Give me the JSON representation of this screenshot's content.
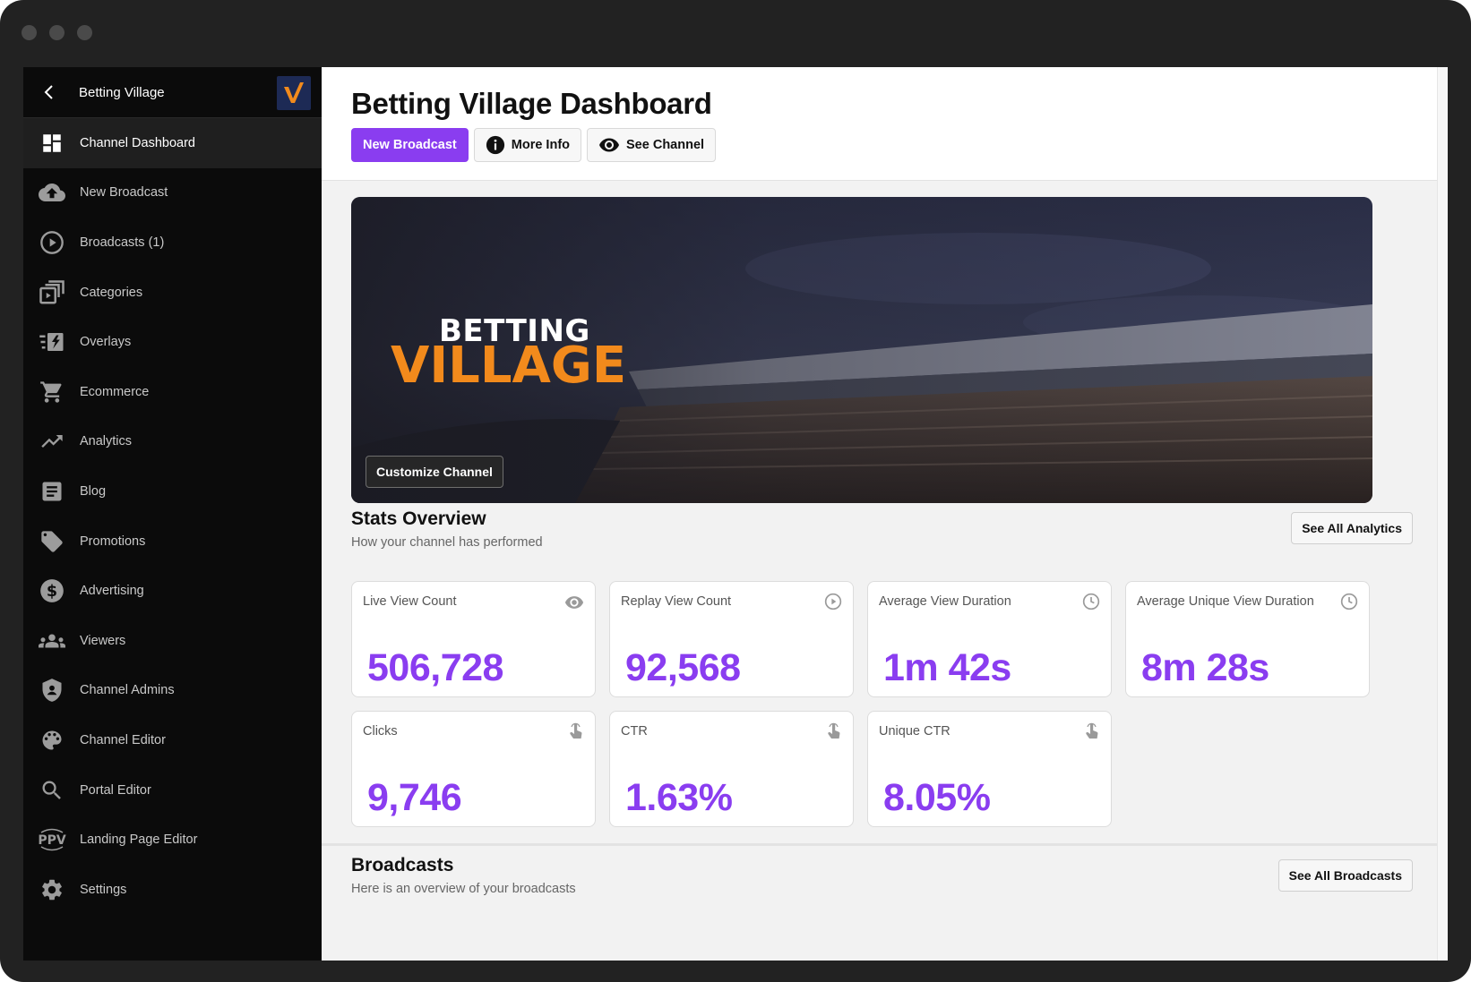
{
  "sidebar": {
    "channel_name": "Betting Village",
    "items": [
      {
        "label": "Channel Dashboard",
        "icon": "dashboard-icon"
      },
      {
        "label": "New Broadcast",
        "icon": "cloud-upload-icon"
      },
      {
        "label": "Broadcasts (1)",
        "icon": "play-circle-icon"
      },
      {
        "label": "Categories",
        "icon": "categories-icon"
      },
      {
        "label": "Overlays",
        "icon": "overlays-icon"
      },
      {
        "label": "Ecommerce",
        "icon": "cart-icon"
      },
      {
        "label": "Analytics",
        "icon": "trending-icon"
      },
      {
        "label": "Blog",
        "icon": "article-icon"
      },
      {
        "label": "Promotions",
        "icon": "tag-icon"
      },
      {
        "label": "Advertising",
        "icon": "dollar-icon"
      },
      {
        "label": "Viewers",
        "icon": "people-icon"
      },
      {
        "label": "Channel Admins",
        "icon": "shield-icon"
      },
      {
        "label": "Channel Editor",
        "icon": "palette-icon"
      },
      {
        "label": "Portal Editor",
        "icon": "search-icon"
      },
      {
        "label": "Landing Page Editor",
        "icon": "ppv-icon"
      },
      {
        "label": "Settings",
        "icon": "gear-icon"
      }
    ]
  },
  "header": {
    "title": "Betting Village Dashboard",
    "new_broadcast": "New Broadcast",
    "more_info": "More Info",
    "see_channel": "See Channel"
  },
  "banner": {
    "logo_line1": "BETTING",
    "logo_line2": "VILLAGE",
    "customize": "Customize Channel"
  },
  "stats": {
    "title": "Stats Overview",
    "subtitle": "How your channel has performed",
    "see_all": "See All Analytics",
    "cards": [
      {
        "label": "Live View Count",
        "value": "506,728",
        "icon": "eye-icon"
      },
      {
        "label": "Replay View Count",
        "value": "92,568",
        "icon": "play-circle-icon"
      },
      {
        "label": "Average View Duration",
        "value": "1m 42s",
        "icon": "clock-icon"
      },
      {
        "label": "Average Unique View Duration",
        "value": "8m 28s",
        "icon": "clock-icon"
      },
      {
        "label": "Clicks",
        "value": "9,746",
        "icon": "touch-icon"
      },
      {
        "label": "CTR",
        "value": "1.63%",
        "icon": "touch-icon"
      },
      {
        "label": "Unique CTR",
        "value": "8.05%",
        "icon": "touch-icon"
      }
    ]
  },
  "broadcasts": {
    "title": "Broadcasts",
    "subtitle": "Here is an overview of your broadcasts",
    "see_all": "See All Broadcasts"
  },
  "colors": {
    "accent": "#8a3df0",
    "brand_orange": "#f28a1c",
    "sidebar_bg": "#0b0b0b"
  }
}
